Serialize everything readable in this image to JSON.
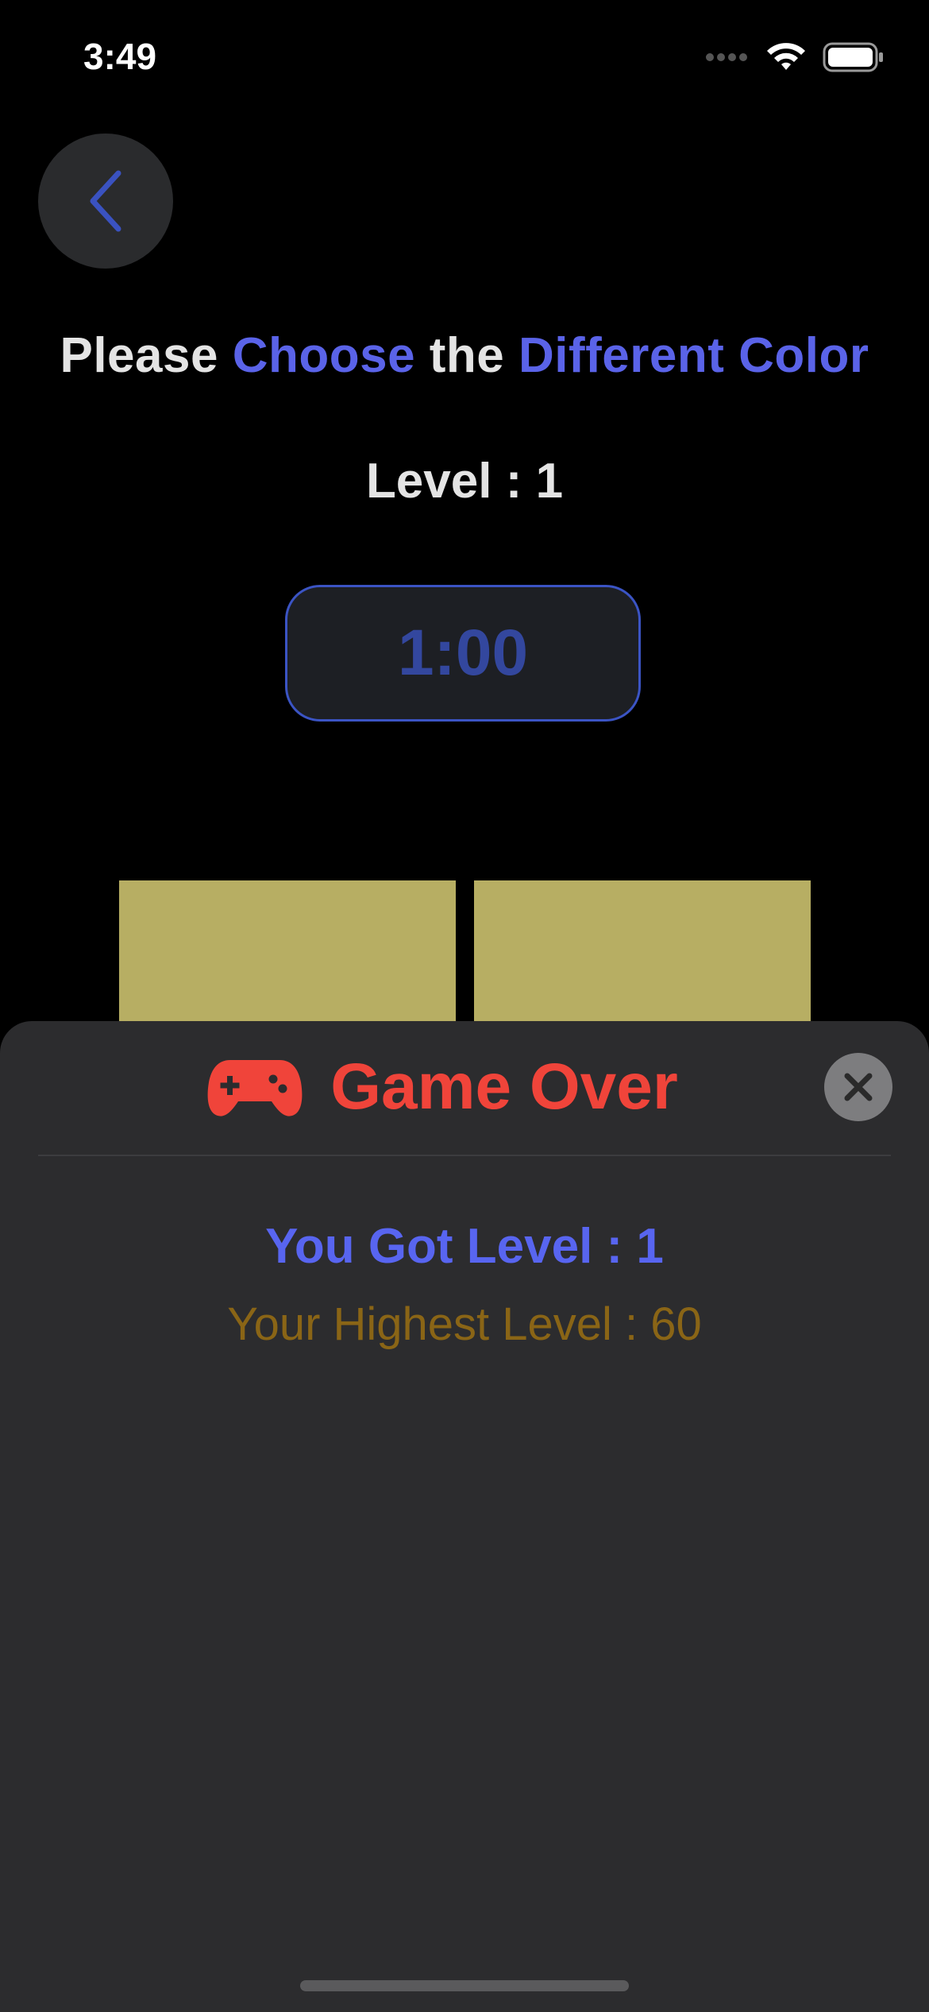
{
  "status_bar": {
    "time": "3:49",
    "icons": [
      "signal-dots-icon",
      "wifi-icon",
      "battery-icon"
    ]
  },
  "header": {
    "back_icon": "chevron-left-icon",
    "instruction": {
      "w1": "Please ",
      "w2": "Choose",
      "w3": " the ",
      "w4": "Different Color"
    },
    "level_text": "Level : 1"
  },
  "timer": {
    "value": "1:00"
  },
  "tiles": {
    "color": "#b7ae63",
    "count_visible": 2
  },
  "game_over_sheet": {
    "icon": "gamepad-icon",
    "title": "Game Over",
    "close_icon": "close-icon",
    "result_text": "You Got Level : 1",
    "highest_text": "Your Highest Level : 60"
  },
  "colors": {
    "accent_blue": "#5a63e8",
    "timer_blue": "#33479e",
    "game_over_red": "#f0443a",
    "highest_gold": "#8a6516",
    "tile_yellow": "#b7ae63"
  }
}
